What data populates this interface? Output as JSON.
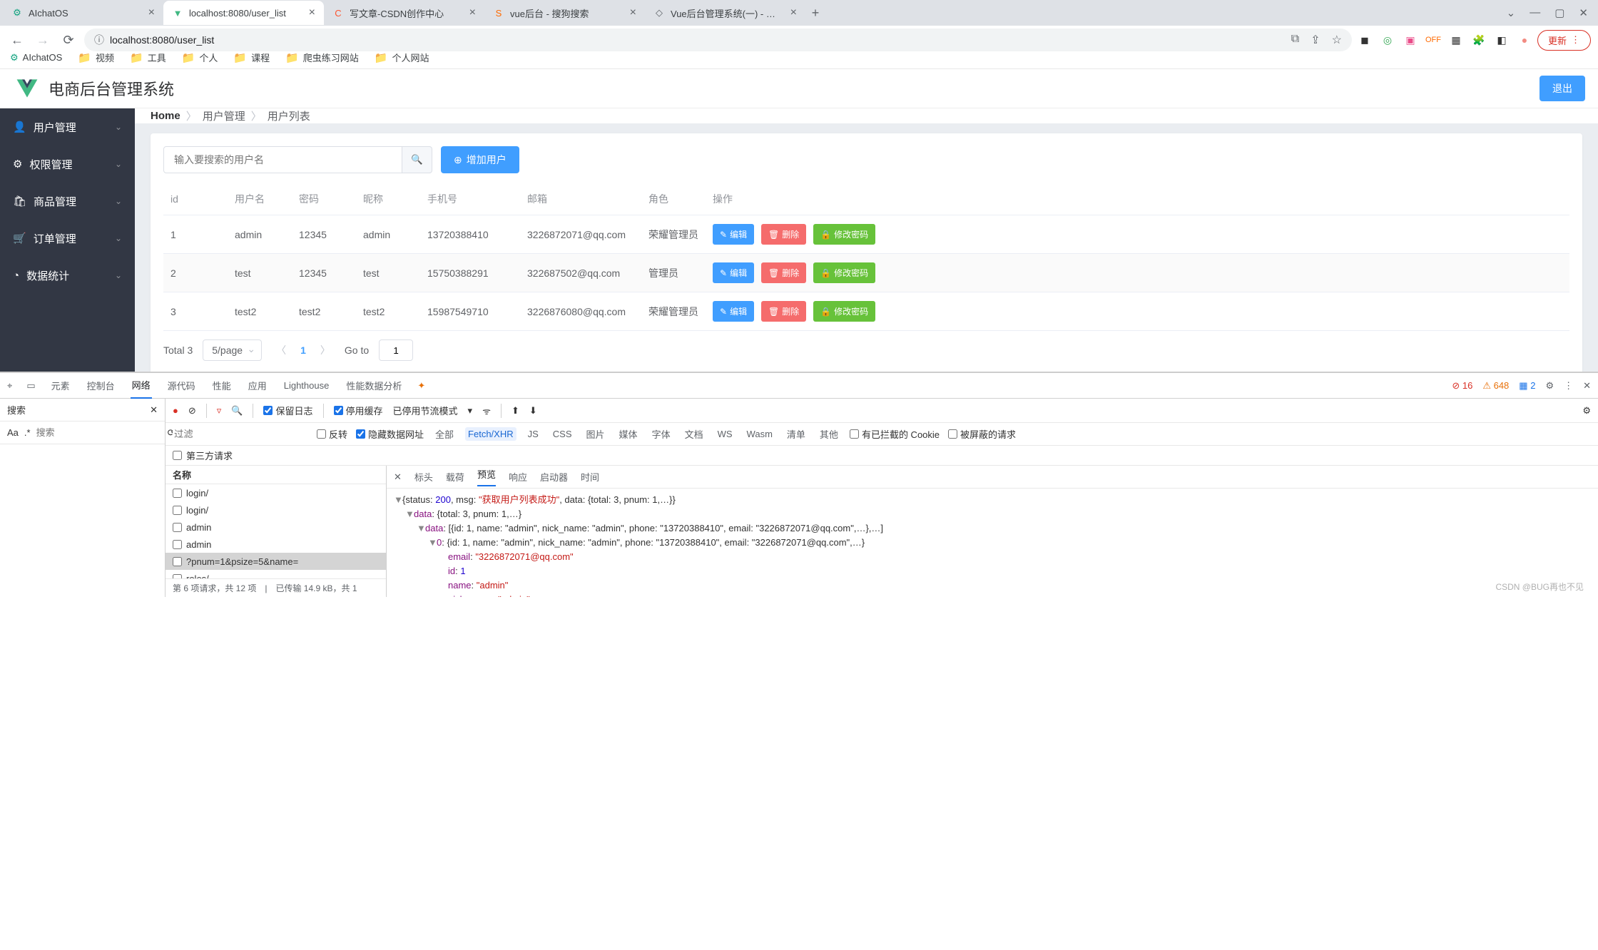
{
  "browser": {
    "tabs": [
      {
        "title": "AIchatOS",
        "active": false,
        "icon": "chatgpt"
      },
      {
        "title": "localhost:8080/user_list",
        "active": true,
        "icon": "vue"
      },
      {
        "title": "写文章-CSDN创作中心",
        "active": false,
        "icon": "csdn"
      },
      {
        "title": "vue后台 - 搜狗搜索",
        "active": false,
        "icon": "sogou"
      },
      {
        "title": "Vue后台管理系统(一) - 清安宁 -",
        "active": false,
        "icon": "generic"
      }
    ],
    "url": "localhost:8080/user_list",
    "update_label": "更新",
    "window_controls": {
      "dropdown": "⌄",
      "min": "—",
      "max": "▢",
      "close": "✕"
    }
  },
  "bookmarks": [
    {
      "label": "AIchatOS",
      "type": "link"
    },
    {
      "label": "视频",
      "type": "folder"
    },
    {
      "label": "工具",
      "type": "folder"
    },
    {
      "label": "个人",
      "type": "folder"
    },
    {
      "label": "课程",
      "type": "folder"
    },
    {
      "label": "爬虫练习网站",
      "type": "folder"
    },
    {
      "label": "个人网站",
      "type": "folder"
    }
  ],
  "page": {
    "title": "电商后台管理系统",
    "logout": "退出",
    "sidebar": [
      {
        "icon": "user",
        "label": "用户管理"
      },
      {
        "icon": "gear",
        "label": "权限管理"
      },
      {
        "icon": "bag",
        "label": "商品管理"
      },
      {
        "icon": "cart",
        "label": "订单管理"
      },
      {
        "icon": "chart",
        "label": "数据统计"
      }
    ],
    "breadcrumb": {
      "home": "Home",
      "p1": "用户管理",
      "p2": "用户列表"
    },
    "search_placeholder": "输入要搜索的用户名",
    "add_user": "增加用户",
    "table": {
      "headers": [
        "id",
        "用户名",
        "密码",
        "昵称",
        "手机号",
        "邮箱",
        "角色",
        "操作"
      ],
      "rows": [
        {
          "id": "1",
          "user": "admin",
          "pwd": "12345",
          "nick": "admin",
          "phone": "13720388410",
          "email": "3226872071@qq.com",
          "role": "荣耀管理员"
        },
        {
          "id": "2",
          "user": "test",
          "pwd": "12345",
          "nick": "test",
          "phone": "15750388291",
          "email": "322687502@qq.com",
          "role": "管理员"
        },
        {
          "id": "3",
          "user": "test2",
          "pwd": "test2",
          "nick": "test2",
          "phone": "15987549710",
          "email": "3226876080@qq.com",
          "role": "荣耀管理员"
        }
      ],
      "op_edit": "编辑",
      "op_del": "删除",
      "op_pwd": "修改密码"
    },
    "pagination": {
      "total": "Total 3",
      "size": "5/page",
      "current": "1",
      "goto_label": "Go to",
      "goto_val": "1"
    }
  },
  "devtools": {
    "tabs": [
      "元素",
      "控制台",
      "网络",
      "源代码",
      "性能",
      "应用",
      "Lighthouse",
      "性能数据分析"
    ],
    "active_tab": "网络",
    "err_count": "16",
    "warn_count": "648",
    "issue_count": "2",
    "search_label": "搜索",
    "search_placeholder": "搜索",
    "search_case": "Aa",
    "search_regex": ".*",
    "preserve_log": "保留日志",
    "disable_cache": "停用缓存",
    "throttling": "已停用节流模式",
    "filter_placeholder": "过滤",
    "invert_label": "反转",
    "hide_data_urls": "隐藏数据网址",
    "filter_types": [
      "全部",
      "Fetch/XHR",
      "JS",
      "CSS",
      "图片",
      "媒体",
      "字体",
      "文档",
      "WS",
      "Wasm",
      "清单",
      "其他"
    ],
    "active_filter": "Fetch/XHR",
    "blocked_cookies": "有已拦截的 Cookie",
    "blocked_req": "被屏蔽的请求",
    "third_party": "第三方请求",
    "req_header": "名称",
    "requests": [
      "login/",
      "login/",
      "admin",
      "admin",
      "?pnum=1&psize=5&name=",
      "roles/"
    ],
    "requests_selected": 4,
    "req_footer": "第 6 项请求，共 12 项　|　已传输 14.9 kB，共 1",
    "preview_tabs": [
      "标头",
      "载荷",
      "预览",
      "响应",
      "启动器",
      "时间"
    ],
    "preview_active": "预览",
    "json_lines": [
      {
        "indent": 0,
        "disc": "▼",
        "content": [
          {
            "t": "kw",
            "v": "{status: "
          },
          {
            "t": "num",
            "v": "200"
          },
          {
            "t": "kw",
            "v": ", msg: "
          },
          {
            "t": "str",
            "v": "\"获取用户列表成功\""
          },
          {
            "t": "kw",
            "v": ", data: {total: 3, pnum: 1,…}}"
          }
        ]
      },
      {
        "indent": 1,
        "disc": "▼",
        "content": [
          {
            "t": "key",
            "v": "data"
          },
          {
            "t": "kw",
            "v": ": {total: 3, pnum: 1,…}"
          }
        ]
      },
      {
        "indent": 2,
        "disc": "▼",
        "content": [
          {
            "t": "key",
            "v": "data"
          },
          {
            "t": "kw",
            "v": ": [{id: 1, name: \"admin\", nick_name: \"admin\", phone: \"13720388410\", email: \"3226872071@qq.com\",…},…]"
          }
        ]
      },
      {
        "indent": 3,
        "disc": "▼",
        "content": [
          {
            "t": "key",
            "v": "0"
          },
          {
            "t": "kw",
            "v": ": {id: 1, name: \"admin\", nick_name: \"admin\", phone: \"13720388410\", email: \"3226872071@qq.com\",…}"
          }
        ]
      },
      {
        "indent": 4,
        "disc": "",
        "content": [
          {
            "t": "key",
            "v": "email"
          },
          {
            "t": "kw",
            "v": ": "
          },
          {
            "t": "str",
            "v": "\"3226872071@qq.com\""
          }
        ]
      },
      {
        "indent": 4,
        "disc": "",
        "content": [
          {
            "t": "key",
            "v": "id"
          },
          {
            "t": "kw",
            "v": ": "
          },
          {
            "t": "num",
            "v": "1"
          }
        ]
      },
      {
        "indent": 4,
        "disc": "",
        "content": [
          {
            "t": "key",
            "v": "name"
          },
          {
            "t": "kw",
            "v": ": "
          },
          {
            "t": "str",
            "v": "\"admin\""
          }
        ]
      },
      {
        "indent": 4,
        "disc": "",
        "content": [
          {
            "t": "key",
            "v": "nick_name"
          },
          {
            "t": "kw",
            "v": ": "
          },
          {
            "t": "str",
            "v": "\"admin\""
          }
        ]
      }
    ],
    "watermark": "CSDN @BUG再也不见"
  }
}
